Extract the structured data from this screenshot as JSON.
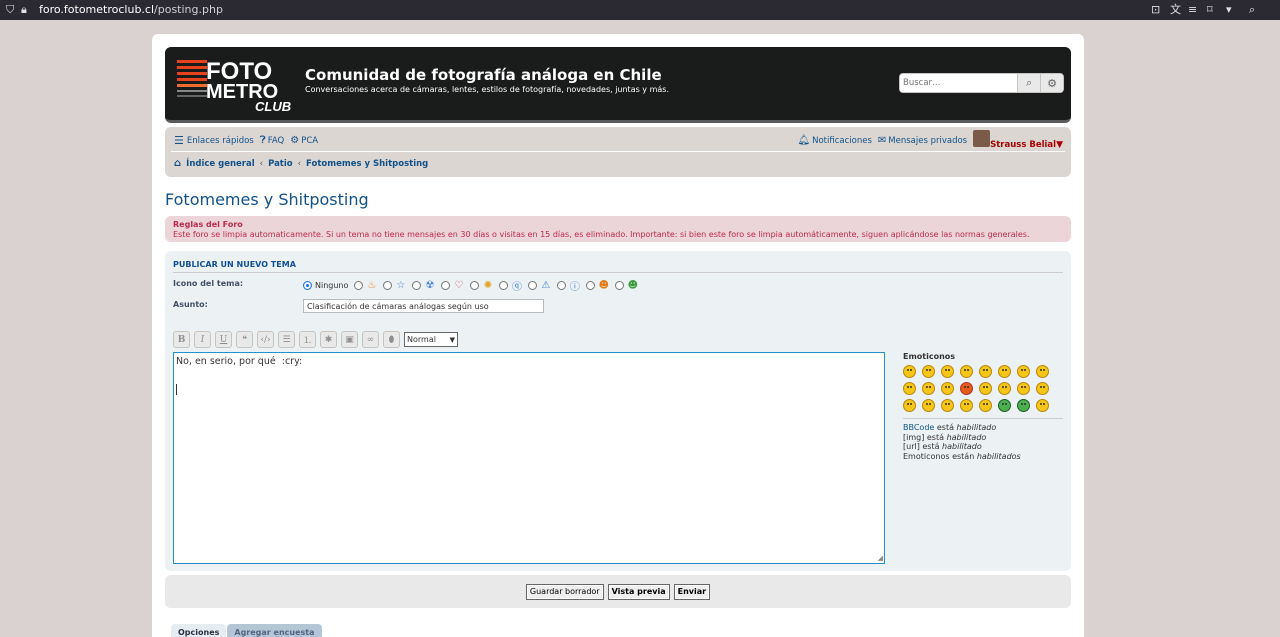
{
  "browser": {
    "url_domain": "foro.fotometroclub.cl",
    "url_path": "/posting.php"
  },
  "header": {
    "logo_line1": "FOTO",
    "logo_line2": "METRO",
    "logo_line3": "CLUB",
    "site_title": "Comunidad de fotografía análoga en Chile",
    "site_description": "Conversaciones acerca de cámaras, lentes, estilos de fotografía, novedades, juntas y más.",
    "search_placeholder": "Buscar…"
  },
  "navbar": {
    "quick_links": "Enlaces rápidos",
    "faq": "FAQ",
    "ucp": "PCA",
    "notifications": "Notificaciones",
    "private_messages": "Mensajes privados",
    "username": "Strauss Belial"
  },
  "breadcrumbs": [
    "Índice general",
    "Patio",
    "Fotomemes y Shitposting"
  ],
  "page_title": "Fotomemes y Shitposting",
  "rules": {
    "title": "Reglas del Foro",
    "text": "Este foro se limpia automaticamente. Si un tema no tiene mensajes en 30 días o visitas en 15 días, es eliminado. Importante: si bien este foro se limpia automáticamente, siguen aplicándose las normas generales."
  },
  "post_form": {
    "panel_title": "PUBLICAR UN NUEVO TEMA",
    "icon_label": "Icono del tema:",
    "icon_none": "Ninguno",
    "subject_label": "Asunto:",
    "subject_value": "Clasificación de cámaras análogas según uso",
    "font_size_value": "Normal",
    "message": "No, en serio, por qué  :cry:"
  },
  "emoticons": {
    "title": "Emoticonos",
    "bbcode_link": "BBCode",
    "bbcode_status": " está ",
    "enabled": "habilitado",
    "img_status": "[img] está ",
    "url_status": "[url] está ",
    "smilies_status": "Emoticonos están ",
    "enabled_plural": "habilitados"
  },
  "buttons": {
    "save_draft": "Guardar borrador",
    "preview": "Vista previa",
    "submit": "Enviar"
  },
  "tabs": {
    "options": "Opciones",
    "add_poll": "Agregar encuesta"
  }
}
